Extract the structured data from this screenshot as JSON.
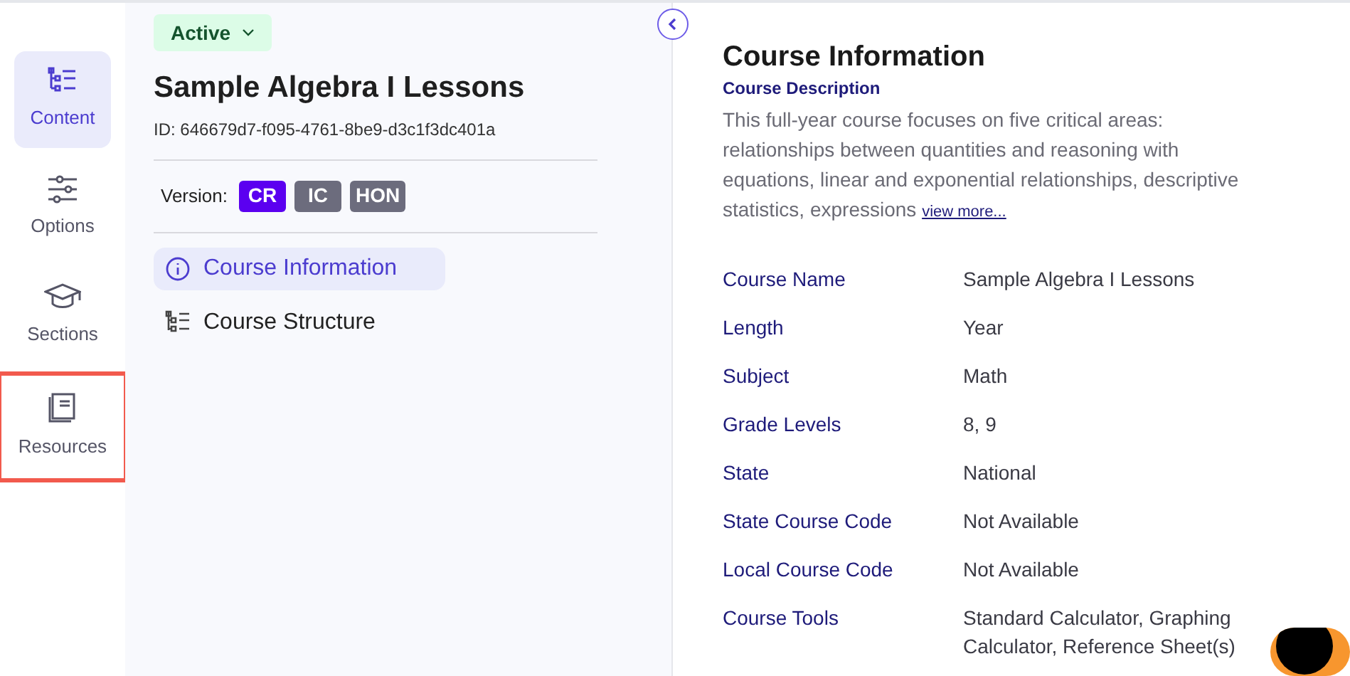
{
  "nav": [
    {
      "label": "Content",
      "kind": "content",
      "selected": true,
      "highlighted": false
    },
    {
      "label": "Options",
      "kind": "options",
      "selected": false,
      "highlighted": false
    },
    {
      "label": "Sections",
      "kind": "sections",
      "selected": false,
      "highlighted": false
    },
    {
      "label": "Resources",
      "kind": "resources",
      "selected": false,
      "highlighted": true
    }
  ],
  "status": {
    "label": "Active"
  },
  "course": {
    "title": "Sample Algebra I Lessons",
    "id": "ID: 646679d7-f095-4761-8be9-d3c1f3dc401a"
  },
  "version": {
    "label": "Version:",
    "options": [
      {
        "label": "CR",
        "selected": true
      },
      {
        "label": "IC",
        "selected": false
      },
      {
        "label": "HON",
        "selected": false
      }
    ]
  },
  "menu": [
    {
      "label": "Course Information",
      "kind": "info",
      "selected": true
    },
    {
      "label": "Course Structure",
      "kind": "structure",
      "selected": false
    }
  ],
  "info": {
    "title": "Course Information",
    "description_label": "Course Description",
    "description": "This full-year course focuses on five critical areas: relationships between quantities and reasoning with equations, linear and exponential relationships, descriptive statistics, expressions",
    "more_link": "view more...",
    "fields": [
      {
        "label": "Course Name",
        "value": "Sample Algebra I Lessons"
      },
      {
        "label": "Length",
        "value": "Year"
      },
      {
        "label": "Subject",
        "value": "Math"
      },
      {
        "label": "Grade Levels",
        "value": "8, 9"
      },
      {
        "label": "State",
        "value": "National"
      },
      {
        "label": "State Course Code",
        "value": "Not Available"
      },
      {
        "label": "Local Course Code",
        "value": "Not Available"
      },
      {
        "label": "Course Tools",
        "value": "Standard Calculator, Graphing Calculator, Reference Sheet(s)"
      }
    ]
  }
}
